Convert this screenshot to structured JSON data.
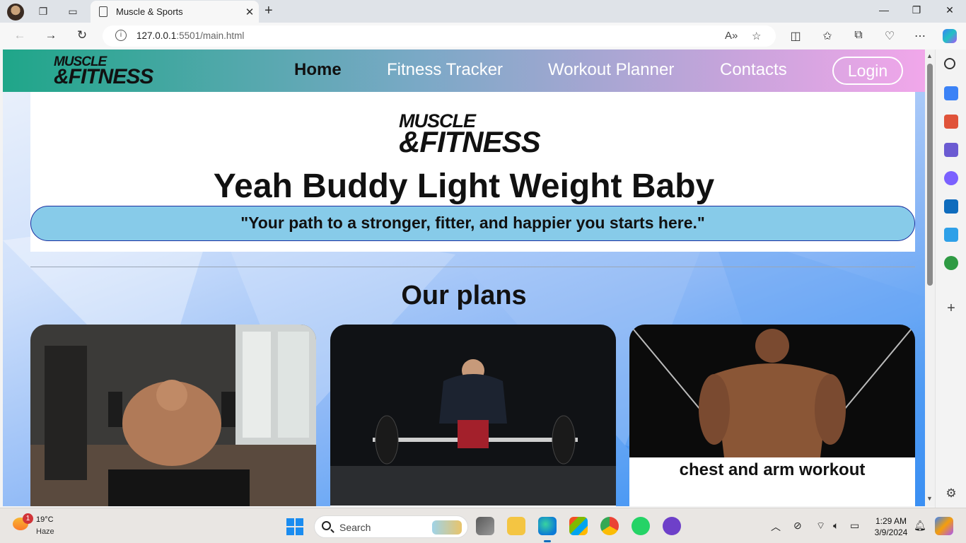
{
  "browser": {
    "tab_title": "Muscle & Sports",
    "url_host": "127.0.0.1",
    "url_path": ":5501/main.html",
    "new_tab_label": "+"
  },
  "site": {
    "logo_line1": "MUSCLE",
    "logo_line2": "&FITNESS",
    "nav": {
      "home": "Home",
      "fitness_tracker": "Fitness Tracker",
      "workout_planner": "Workout Planner",
      "contacts": "Contacts",
      "login": "Login"
    },
    "headline": "Yeah Buddy Light Weight Baby",
    "quote": "\"Your path to a stronger, fitter, and happier you starts here.\"",
    "plans_title": "Our plans",
    "plans": [
      {
        "caption": ""
      },
      {
        "caption": ""
      },
      {
        "caption": "chest and arm workout"
      }
    ]
  },
  "taskbar": {
    "weather_badge": "1",
    "temperature": "19°C",
    "condition": "Haze",
    "search_label": "Search",
    "time": "1:29 AM",
    "date": "3/9/2024"
  },
  "colors": {
    "nav_gradient_start": "#1fa689",
    "nav_gradient_end": "#f1a7ea",
    "quote_bg": "#87cbe9",
    "quote_border": "#1b2fa0",
    "page_bg_blue": "#4f9bf4"
  }
}
